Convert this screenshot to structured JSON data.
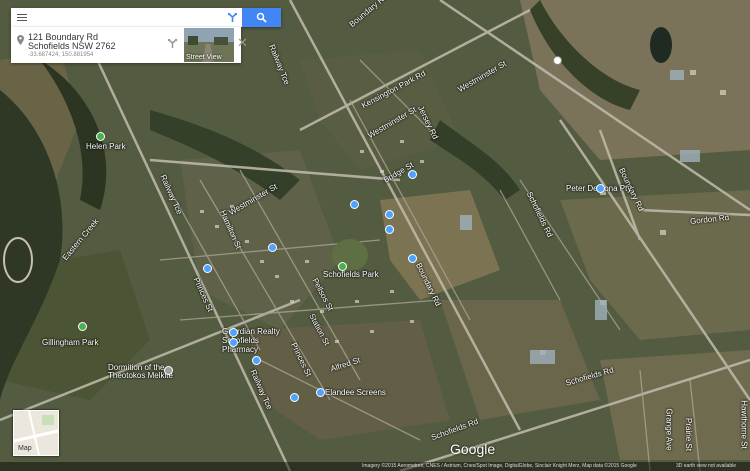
{
  "search": {
    "placeholder": "",
    "value": ""
  },
  "place_card": {
    "address_line1": "121 Boundary Rd",
    "address_line2": "Schofields NSW 2762",
    "coordinates": "-33.687424, 150.881954",
    "street_view_label": "Street View"
  },
  "map_labels": {
    "roads": [
      "Boundary Rd",
      "Westminster St",
      "Kensington Park Rd",
      "Westminster St",
      "Railway Tce",
      "Westminster St",
      "Bridge St",
      "Railway Tce",
      "Schofields Rd",
      "Schofields Rd",
      "Schofields Rd",
      "Jersey Rd",
      "Boundary Rd",
      "Gordon Rd",
      "Railway Tce",
      "Boundary Rd",
      "Station St",
      "Pellsos St",
      "Alfred St",
      "Princes St",
      "Hamilton St",
      "Hawthorne St",
      "Grange Ave",
      "Prairie St",
      "Princes St"
    ],
    "places": [
      "Helen Park",
      "Eastern Creek",
      "Schofields Park",
      "Gillingham Park",
      "Peter Demona Pty",
      "Guardian Realty",
      "Schofields Pharmacy",
      "Dormition of the Theotokos Melkite",
      "Elandee Screens"
    ]
  },
  "mini_map_label": "Map",
  "google_logo": "Google",
  "attribution": {
    "imagery": "Imagery ©2015 Aerometrex, CNES / Astrium, Cnes/Spot Image, DigitalGlobe, Sinclair Knight Merz, Map data ©2015 Google",
    "note": "3D earth view not available"
  },
  "colors": {
    "search_button": "#4285f4",
    "poi_marker": "#4da3ff"
  }
}
